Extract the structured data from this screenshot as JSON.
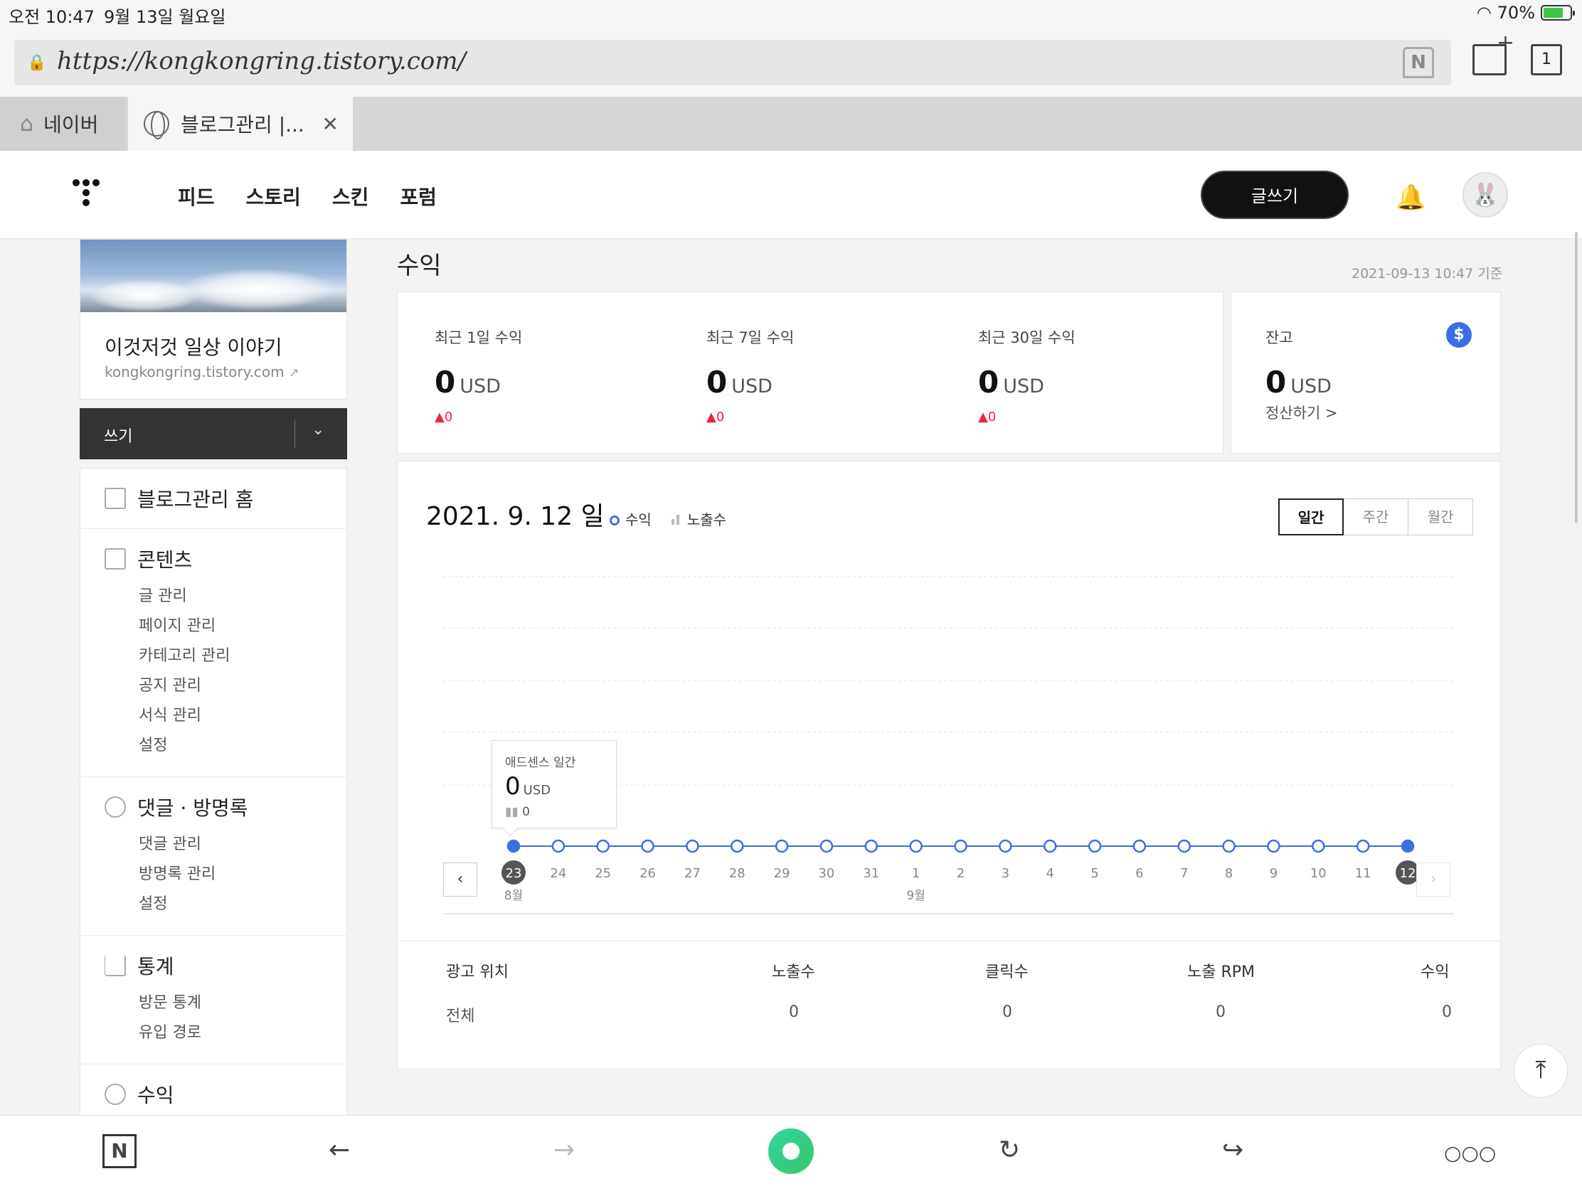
{
  "status": {
    "time": "오전 10:47",
    "date": "9월 13일 월요일",
    "battery": "70%"
  },
  "browser": {
    "url": "https://kongkongring.tistory.com/",
    "tab_count": "1",
    "tabs": [
      {
        "label": "네이버"
      },
      {
        "label": "블로그관리 |..."
      }
    ]
  },
  "header": {
    "nav": [
      "피드",
      "스토리",
      "스킨",
      "포럼"
    ],
    "write_label": "글쓰기"
  },
  "sidebar": {
    "blog_name": "이것저것 일상 이야기",
    "blog_url": "kongkongring.tistory.com",
    "write_label": "쓰기",
    "home_label": "블로그관리 홈",
    "sections": [
      {
        "title": "콘텐츠",
        "items": [
          "글 관리",
          "페이지 관리",
          "카테고리 관리",
          "공지 관리",
          "서식 관리",
          "설정"
        ]
      },
      {
        "title": "댓글 · 방명록",
        "items": [
          "댓글 관리",
          "방명록 관리",
          "설정"
        ]
      },
      {
        "title": "통계",
        "items": [
          "방문 통계",
          "유입 경로"
        ]
      },
      {
        "title": "수익",
        "items": []
      }
    ]
  },
  "main": {
    "title": "수익",
    "timestamp": "2021-09-13 10:47 기준",
    "stats": [
      {
        "label": "최근 1일 수익",
        "value": "0",
        "unit": "USD",
        "delta": "▲0"
      },
      {
        "label": "최근 7일 수익",
        "value": "0",
        "unit": "USD",
        "delta": "▲0"
      },
      {
        "label": "최근 30일 수익",
        "value": "0",
        "unit": "USD",
        "delta": "▲0"
      }
    ],
    "balance": {
      "label": "잔고",
      "value": "0",
      "unit": "USD",
      "settle": "정산하기 >"
    },
    "chart_date": "2021. 9. 12 일",
    "legend": {
      "revenue": "수익",
      "impressions": "노출수"
    },
    "periods": [
      "일간",
      "주간",
      "월간"
    ],
    "tooltip": {
      "title": "애드센스 일간",
      "value": "0",
      "unit": "USD",
      "impressions": "0"
    },
    "table": {
      "headers": [
        "광고 위치",
        "노출수",
        "클릭수",
        "노출 RPM",
        "수익"
      ],
      "rows": [
        [
          "전체",
          "0",
          "0",
          "0",
          "0"
        ]
      ]
    }
  },
  "chart_data": {
    "type": "line",
    "x": [
      "23",
      "24",
      "25",
      "26",
      "27",
      "28",
      "29",
      "30",
      "31",
      "1",
      "2",
      "3",
      "4",
      "5",
      "6",
      "7",
      "8",
      "9",
      "10",
      "11",
      "12"
    ],
    "month_labels": [
      {
        "index": 0,
        "label": "8월"
      },
      {
        "index": 9,
        "label": "9월"
      }
    ],
    "series": [
      {
        "name": "수익",
        "values": [
          0,
          0,
          0,
          0,
          0,
          0,
          0,
          0,
          0,
          0,
          0,
          0,
          0,
          0,
          0,
          0,
          0,
          0,
          0,
          0,
          0
        ]
      }
    ],
    "highlighted": [
      0,
      20
    ],
    "color": "#3d6fe0",
    "grid": true
  }
}
